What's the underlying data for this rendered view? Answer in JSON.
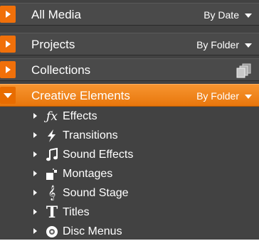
{
  "headers": [
    {
      "title": "All Media",
      "sort": "By Date"
    },
    {
      "title": "Projects",
      "sort": "By Folder"
    },
    {
      "title": "Collections",
      "icon": "stacked-media-icon"
    },
    {
      "title": "Creative Elements",
      "sort": "By Folder"
    }
  ],
  "items": [
    {
      "label": "Effects",
      "icon": "fx-icon"
    },
    {
      "label": "Transitions",
      "icon": "lightning-icon"
    },
    {
      "label": "Sound Effects",
      "icon": "music-note-icon"
    },
    {
      "label": "Montages",
      "icon": "montage-icon"
    },
    {
      "label": "Sound Stage",
      "icon": "treble-clef-icon"
    },
    {
      "label": "Titles",
      "icon": "title-t-icon"
    },
    {
      "label": "Disc Menus",
      "icon": "disc-icon"
    }
  ],
  "colors": {
    "panel": "#424242",
    "accent": "#f0700a",
    "active_header": "#f08a20"
  }
}
